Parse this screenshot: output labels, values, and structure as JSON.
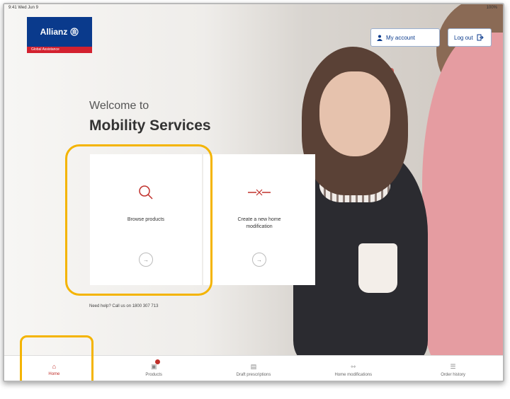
{
  "status_bar": {
    "left": "9:41  Wed Jun 9",
    "right": "100%"
  },
  "logo": {
    "brand": "Allianz",
    "tagline": "Global Assistance"
  },
  "header": {
    "account_label": "My account",
    "logout_label": "Log out"
  },
  "welcome": {
    "line1": "Welcome to",
    "title": "Mobility Services"
  },
  "cards": [
    {
      "label": "Browse products",
      "icon": "search-icon"
    },
    {
      "label": "Create a new home modification",
      "icon": "ramp-icon"
    }
  ],
  "help_text": "Need help? Call us on 1800 307 713",
  "bottom_nav": [
    {
      "label": "Home",
      "icon": "home-icon",
      "active": true
    },
    {
      "label": "Products",
      "icon": "products-icon",
      "badge": true
    },
    {
      "label": "Draft prescriptions",
      "icon": "document-icon"
    },
    {
      "label": "Home modifications",
      "icon": "ramp-icon"
    },
    {
      "label": "Order history",
      "icon": "history-icon"
    }
  ],
  "colors": {
    "brand_blue": "#0a3a8c",
    "brand_red": "#d3212f",
    "highlight": "#f4b400",
    "active": "#c0302b"
  }
}
